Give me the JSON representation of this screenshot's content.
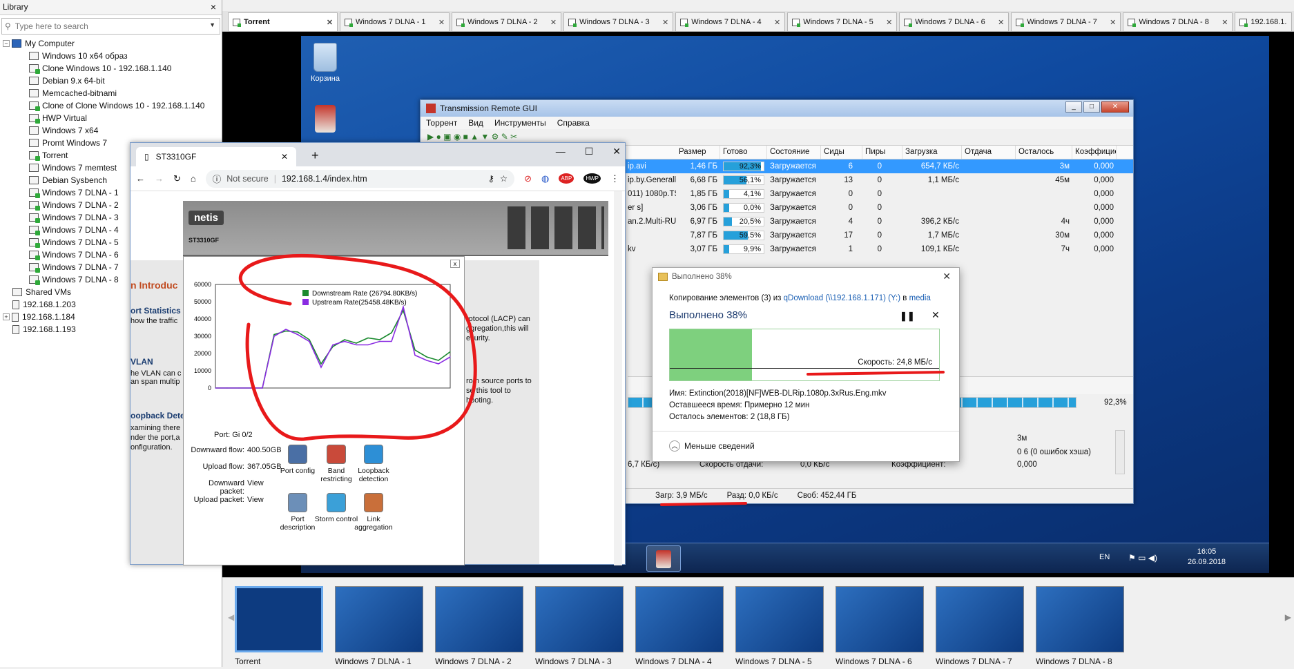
{
  "library": {
    "title": "Library",
    "search_placeholder": "Type here to search",
    "root": "My Computer",
    "vms": [
      "Windows 10 x64 образ",
      "Clone Windows 10 - 192.168.1.140",
      "Debian 9.x 64-bit",
      "Memcached-bitnami",
      "Clone of Clone Windows 10 - 192.168.1.140",
      "HWP Virtual",
      "Windows 7 x64",
      "Promt Windows 7",
      "Torrent",
      "Windows 7 memtest",
      "Debian Sysbench",
      "Windows 7 DLNA - 1",
      "Windows 7 DLNA - 2",
      "Windows 7 DLNA - 3",
      "Windows 7 DLNA - 4",
      "Windows 7 DLNA - 5",
      "Windows 7 DLNA - 6",
      "Windows 7 DLNA - 7",
      "Windows 7 DLNA - 8"
    ],
    "shared": "Shared VMs",
    "hosts": [
      "192.168.1.203",
      "192.168.1.184",
      "192.168.1.193"
    ]
  },
  "tabs": [
    "Torrent",
    "Windows 7 DLNA - 1",
    "Windows 7 DLNA - 2",
    "Windows 7 DLNA - 3",
    "Windows 7 DLNA - 4",
    "Windows 7 DLNA - 5",
    "Windows 7 DLNA - 6",
    "Windows 7 DLNA - 7",
    "Windows 7 DLNA - 8",
    "192.168.1."
  ],
  "desktop": {
    "recycle_bin": "Корзина"
  },
  "transmission": {
    "title": "Transmission Remote GUI",
    "menu": [
      "Торрент",
      "Вид",
      "Инструменты",
      "Справка"
    ],
    "columns": [
      "Размер",
      "Готово",
      "Состояние",
      "Сиды",
      "Пиры",
      "Загрузка",
      "Отдача",
      "Осталось",
      "Коэффицие"
    ],
    "rows": [
      {
        "name": "ip.avi",
        "size": "1,46 ГБ",
        "done": "92,3%",
        "state": "Загружается",
        "seeds": "6",
        "peers": "0",
        "down": "654,7 КБ/с",
        "up": "",
        "left": "3м",
        "ratio": "0,000"
      },
      {
        "name": "ip.by.Generall",
        "size": "6,68 ГБ",
        "done": "56,1%",
        "state": "Загружается",
        "seeds": "13",
        "peers": "0",
        "down": "1,1 МБ/с",
        "up": "",
        "left": "45м",
        "ratio": "0,000"
      },
      {
        "name": "011) 1080p.TS",
        "size": "1,85 ГБ",
        "done": "4,1%",
        "state": "Загружается",
        "seeds": "0",
        "peers": "0",
        "down": "",
        "up": "",
        "left": "",
        "ratio": "0,000"
      },
      {
        "name": "er s]",
        "size": "3,06 ГБ",
        "done": "0,0%",
        "state": "Загружается",
        "seeds": "0",
        "peers": "0",
        "down": "",
        "up": "",
        "left": "",
        "ratio": "0,000"
      },
      {
        "name": "an.2.Multi-RU",
        "size": "6,97 ГБ",
        "done": "20,5%",
        "state": "Загружается",
        "seeds": "4",
        "peers": "0",
        "down": "396,2 КБ/с",
        "up": "",
        "left": "4ч",
        "ratio": "0,000"
      },
      {
        "name": "",
        "size": "7,87 ГБ",
        "done": "59,5%",
        "state": "Загружается",
        "seeds": "17",
        "peers": "0",
        "down": "1,7 МБ/с",
        "up": "",
        "left": "30м",
        "ratio": "0,000"
      },
      {
        "name": "kv",
        "size": "3,07 ГБ",
        "done": "9,9%",
        "state": "Загружается",
        "seeds": "1",
        "peers": "0",
        "down": "109,1 КБ/с",
        "up": "",
        "left": "7ч",
        "ratio": "0,000"
      }
    ],
    "done_fractions": [
      0.923,
      0.561,
      0.041,
      0.0,
      0.205,
      0.595,
      0.099
    ],
    "detail_percent": "92,3%",
    "detail_left": "3м",
    "detail_hash": "0 6 (0 ошибок хэша)",
    "detail_ratio_val": "0,000",
    "detail_speed_left": "6,7 КБ/с)",
    "upload_speed_label": "Скорость отдачи:",
    "upload_speed_val": "0,0 КБ/с",
    "ratio_label": "Коэффициент:",
    "status_down": "Загр: 3,9 МБ/с",
    "status_up": "Разд: 0,0 КБ/с",
    "status_free": "Своб: 452,44 ГБ"
  },
  "copy_dialog": {
    "title": "Выполнено 38%",
    "line1_prefix": "Копирование элементов (3) из ",
    "line1_src": "qDownload (\\\\192.168.1.171) (Y:)",
    "line1_mid": " в ",
    "line1_dst": "media",
    "progress_title": "Выполнено 38%",
    "progress_fraction": 0.38,
    "speed": "Скорость: 24,8 МБ/с",
    "name_label": "Имя:",
    "name_val": "Extinction(2018)[NF]WEB-DLRip.1080p.3xRus.Eng.mkv",
    "time_label": "Оставшееся время:",
    "time_val": "Примерно 12 мин",
    "items_label": "Осталось элементов:",
    "items_val": "2 (18,8 ГБ)",
    "less": "Меньше сведений"
  },
  "chrome": {
    "tab_title": "ST3310GF",
    "not_secure": "Not secure",
    "url": "192.168.1.4/index.htm",
    "brand": "netis",
    "model": "ST3310GF",
    "section_title": "n Introduc",
    "port_stats": "ort Statistics",
    "port_stats_text": "how the traffic",
    "vlan": "VLAN",
    "vlan_text": "he VLAN can c\nan span multip",
    "loopback": "oopback Detec",
    "loopback_text": "xamining there\nnder the port,a\nonfiguration.",
    "lacp_text": "rotocol (LACP) can\nggregation,this will\necurity.",
    "mirror_text": "rom source ports to\nse this tool to\nhooting.",
    "port_label": "Port:",
    "port_val": "Gi 0/2",
    "down_flow_label": "Downward flow:",
    "down_flow_val": "400.50GB",
    "up_flow_label": "Upload flow:",
    "up_flow_val": "367.05GB",
    "down_packet_label": "Downward packet:",
    "down_packet_val": "View",
    "up_packet_label": "Upload packet:",
    "up_packet_val": "View",
    "icons": [
      "Port config",
      "Band restricting",
      "Loopback detection",
      "Port description",
      "Storm control",
      "Link aggregation"
    ]
  },
  "chart_data": {
    "type": "line",
    "series": [
      {
        "name": "Downstream Rate (26794.80KB/s)",
        "color": "#1a8a2e",
        "values": [
          0,
          0,
          0,
          0,
          0,
          31000,
          33000,
          32500,
          28000,
          14000,
          24000,
          28000,
          26000,
          29000,
          28000,
          32000,
          45000,
          22000,
          18000,
          16000,
          21000
        ]
      },
      {
        "name": "Upstream Rate(25458.48KB/s)",
        "color": "#8a2be2",
        "values": [
          0,
          0,
          0,
          0,
          0,
          30000,
          34000,
          31000,
          27000,
          12000,
          25000,
          27000,
          25000,
          25000,
          27000,
          27000,
          47000,
          19000,
          16000,
          14000,
          18000
        ]
      }
    ],
    "yticks": [
      "60000",
      "50000",
      "40000",
      "30000",
      "20000",
      "10000",
      "0"
    ],
    "ylim": [
      0,
      60000
    ]
  },
  "taskbar": {
    "lang": "EN",
    "time": "16:05",
    "date": "26.09.2018"
  },
  "thumbnails": [
    "Torrent",
    "Windows 7 DLNA - 1",
    "Windows 7 DLNA - 2",
    "Windows 7 DLNA - 3",
    "Windows 7 DLNA - 4",
    "Windows 7 DLNA - 5",
    "Windows 7 DLNA - 6",
    "Windows 7 DLNA - 7",
    "Windows 7 DLNA - 8"
  ],
  "colors": {
    "annotation": "#e8191a",
    "selection": "#3399ff",
    "progress": "#26a0da"
  }
}
